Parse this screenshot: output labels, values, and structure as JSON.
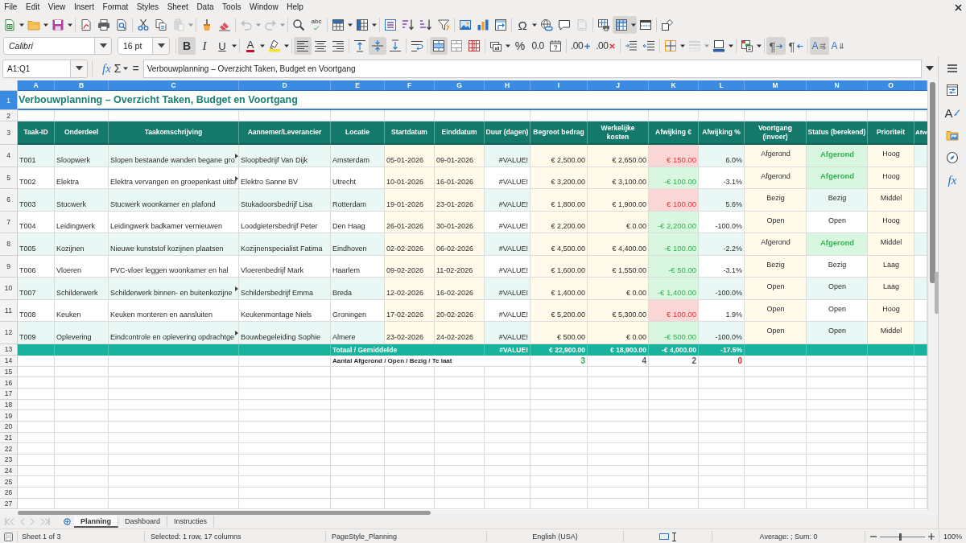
{
  "menu_bar": [
    "File",
    "Edit",
    "View",
    "Insert",
    "Format",
    "Styles",
    "Sheet",
    "Data",
    "Tools",
    "Window",
    "Help"
  ],
  "standard_toolbar": [
    [
      {
        "kind": "new",
        "active": false,
        "disabled": false,
        "dropdown": true
      },
      {
        "kind": "open",
        "active": false,
        "disabled": false,
        "dropdown": true
      },
      {
        "kind": "save",
        "active": false,
        "disabled": false,
        "dropdown": true
      }
    ],
    [
      {
        "kind": "pdf",
        "active": false,
        "disabled": false,
        "dropdown": false
      },
      {
        "kind": "print",
        "active": false,
        "disabled": false,
        "dropdown": false
      },
      {
        "kind": "preview",
        "active": false,
        "disabled": false,
        "dropdown": false
      }
    ],
    [
      {
        "kind": "cut",
        "active": false,
        "disabled": false,
        "dropdown": false
      },
      {
        "kind": "copy",
        "active": false,
        "disabled": false,
        "dropdown": false
      },
      {
        "kind": "paste",
        "active": false,
        "disabled": true,
        "dropdown": true
      }
    ],
    [
      {
        "kind": "clone",
        "active": false,
        "disabled": false,
        "dropdown": false
      },
      {
        "kind": "clear",
        "active": false,
        "disabled": false,
        "dropdown": false
      }
    ],
    [
      {
        "kind": "undo",
        "active": false,
        "disabled": true,
        "dropdown": true
      },
      {
        "kind": "redo",
        "active": false,
        "disabled": true,
        "dropdown": true
      }
    ],
    [
      {
        "kind": "find",
        "active": false,
        "disabled": false,
        "dropdown": false
      },
      {
        "kind": "spelling",
        "glyph": "abc",
        "active": false,
        "disabled": false,
        "dropdown": false
      }
    ],
    [
      {
        "kind": "rows",
        "active": false,
        "disabled": false,
        "dropdown": true
      },
      {
        "kind": "columns",
        "active": false,
        "disabled": false,
        "dropdown": true
      }
    ],
    [
      {
        "kind": "sort",
        "active": false,
        "disabled": false,
        "dropdown": false
      },
      {
        "kind": "sort_asc",
        "active": false,
        "disabled": false,
        "dropdown": false
      },
      {
        "kind": "sort_desc",
        "active": false,
        "disabled": false,
        "dropdown": false
      },
      {
        "kind": "filter",
        "active": false,
        "disabled": false,
        "dropdown": false
      }
    ],
    [
      {
        "kind": "image",
        "active": false,
        "disabled": false,
        "dropdown": false
      },
      {
        "kind": "chart",
        "active": false,
        "disabled": false,
        "dropdown": false
      },
      {
        "kind": "pivot",
        "active": false,
        "disabled": false,
        "dropdown": false
      }
    ],
    [
      {
        "kind": "special",
        "glyph": "Ω",
        "active": false,
        "disabled": false,
        "dropdown": true
      },
      {
        "kind": "hyperlink",
        "active": false,
        "disabled": false,
        "dropdown": false
      },
      {
        "kind": "comment",
        "active": false,
        "disabled": false,
        "dropdown": false
      },
      {
        "kind": "headers",
        "active": false,
        "disabled": true,
        "dropdown": false
      }
    ],
    [
      {
        "kind": "print_area",
        "active": false,
        "disabled": false,
        "dropdown": false
      },
      {
        "kind": "freeze",
        "active": true,
        "disabled": false,
        "dropdown": true
      },
      {
        "kind": "split",
        "active": false,
        "disabled": false,
        "dropdown": false
      }
    ],
    [
      {
        "kind": "draw",
        "active": false,
        "disabled": false,
        "dropdown": false
      }
    ]
  ],
  "formatting_toolbar": {
    "font_name": "Calibri",
    "font_size": "16 pt",
    "groups": [
      [
        {
          "kind": "bold",
          "glyph": "B",
          "active": true,
          "disabled": false,
          "dropdown": false
        },
        {
          "kind": "italic",
          "glyph": "I",
          "active": false,
          "disabled": false,
          "dropdown": false
        },
        {
          "kind": "underline",
          "glyph": "U",
          "active": false,
          "disabled": false,
          "dropdown": true
        }
      ],
      [
        {
          "kind": "font_color",
          "glyph": "A",
          "active": false,
          "disabled": false,
          "dropdown": true
        },
        {
          "kind": "highlight",
          "active": false,
          "disabled": false,
          "dropdown": true
        }
      ],
      [
        {
          "kind": "align_left",
          "active": true,
          "disabled": false,
          "dropdown": false
        },
        {
          "kind": "align_center",
          "active": false,
          "disabled": false,
          "dropdown": false
        },
        {
          "kind": "align_right",
          "active": false,
          "disabled": false,
          "dropdown": false
        }
      ],
      [
        {
          "kind": "valign_top",
          "active": false,
          "disabled": false,
          "dropdown": false
        },
        {
          "kind": "valign_middle",
          "active": true,
          "disabled": false,
          "dropdown": false
        },
        {
          "kind": "valign_bottom",
          "active": false,
          "disabled": false,
          "dropdown": false
        }
      ],
      [
        {
          "kind": "wrap",
          "active": false,
          "disabled": false,
          "dropdown": false
        }
      ],
      [
        {
          "kind": "merge_center",
          "active": true,
          "disabled": false,
          "dropdown": false
        },
        {
          "kind": "merge",
          "active": false,
          "disabled": false,
          "dropdown": false
        },
        {
          "kind": "unmerge",
          "active": false,
          "disabled": false,
          "dropdown": false
        }
      ],
      [
        {
          "kind": "currency",
          "active": false,
          "disabled": false,
          "dropdown": true
        },
        {
          "kind": "percent",
          "glyph": "%",
          "active": false,
          "disabled": false,
          "dropdown": false
        },
        {
          "kind": "number",
          "glyph": "0.0",
          "active": false,
          "disabled": false,
          "dropdown": false
        },
        {
          "kind": "date",
          "active": false,
          "disabled": false,
          "dropdown": false
        }
      ],
      [
        {
          "kind": "add_decimal",
          "glyph": ".00",
          "active": false,
          "disabled": false,
          "dropdown": false
        },
        {
          "kind": "del_decimal",
          "glyph": ".00",
          "active": false,
          "disabled": false,
          "dropdown": false
        }
      ],
      [
        {
          "kind": "indent_inc",
          "active": false,
          "disabled": false,
          "dropdown": false
        },
        {
          "kind": "indent_dec",
          "active": false,
          "disabled": false,
          "dropdown": false
        }
      ],
      [
        {
          "kind": "borders",
          "active": false,
          "disabled": false,
          "dropdown": true
        },
        {
          "kind": "border_style",
          "active": false,
          "disabled": true,
          "dropdown": true
        },
        {
          "kind": "border_color",
          "active": false,
          "disabled": false,
          "dropdown": true
        }
      ],
      [
        {
          "kind": "conditional",
          "active": false,
          "disabled": false,
          "dropdown": true
        }
      ],
      [
        {
          "kind": "ltr",
          "glyph": "¶",
          "active": true,
          "disabled": false,
          "dropdown": false
        },
        {
          "kind": "rtl",
          "glyph": "¶",
          "active": false,
          "disabled": false,
          "dropdown": false
        }
      ],
      [
        {
          "kind": "text_dir",
          "glyph": "A",
          "active": true,
          "disabled": false,
          "dropdown": false
        },
        {
          "kind": "vertical",
          "glyph": "A",
          "active": false,
          "disabled": false,
          "dropdown": false
        }
      ]
    ]
  },
  "formula_bar": {
    "name_box": "A1:Q1",
    "buttons": [
      {
        "kind": "function_wizard",
        "glyph": "fx",
        "dropdown": false
      },
      {
        "kind": "sum",
        "glyph": "Σ",
        "dropdown": true
      },
      {
        "kind": "formula",
        "glyph": "=",
        "dropdown": false
      }
    ],
    "content": "Verbouwplanning – Overzicht Taken, Budget en Voortgang"
  },
  "sidebar": [
    {
      "kind": "properties"
    },
    {
      "kind": "styles",
      "glyph": "A"
    },
    {
      "kind": "gallery"
    },
    {
      "kind": "navigator"
    },
    {
      "kind": "functions",
      "glyph": "fx"
    }
  ],
  "sheet": {
    "column_headers": [
      {
        "label": "A",
        "selected": true
      },
      {
        "label": "B",
        "selected": true
      },
      {
        "label": "C",
        "selected": true
      },
      {
        "label": "D",
        "selected": true
      },
      {
        "label": "E",
        "selected": true
      },
      {
        "label": "F",
        "selected": true
      },
      {
        "label": "G",
        "selected": true
      },
      {
        "label": "H",
        "selected": true
      },
      {
        "label": "I",
        "selected": true
      },
      {
        "label": "J",
        "selected": true
      },
      {
        "label": "K",
        "selected": true
      },
      {
        "label": "L",
        "selected": true
      },
      {
        "label": "M",
        "selected": true
      },
      {
        "label": "N",
        "selected": true
      },
      {
        "label": "O",
        "selected": true
      }
    ],
    "row_headers": [
      {
        "label": "1",
        "selected": true
      },
      {
        "label": "2",
        "selected": false
      },
      {
        "label": "3",
        "selected": false
      },
      {
        "label": "4",
        "selected": false
      },
      {
        "label": "5",
        "selected": false
      },
      {
        "label": "6",
        "selected": false
      },
      {
        "label": "7",
        "selected": false
      },
      {
        "label": "8",
        "selected": false
      },
      {
        "label": "9",
        "selected": false
      },
      {
        "label": "10",
        "selected": false
      },
      {
        "label": "11",
        "selected": false
      },
      {
        "label": "12",
        "selected": false
      },
      {
        "label": "13",
        "selected": false
      },
      {
        "label": "14",
        "selected": false
      },
      {
        "label": "15",
        "selected": false
      },
      {
        "label": "16",
        "selected": false
      },
      {
        "label": "17",
        "selected": false
      },
      {
        "label": "18",
        "selected": false
      },
      {
        "label": "19",
        "selected": false
      },
      {
        "label": "20",
        "selected": false
      },
      {
        "label": "21",
        "selected": false
      },
      {
        "label": "22",
        "selected": false
      },
      {
        "label": "23",
        "selected": false
      },
      {
        "label": "24",
        "selected": false
      },
      {
        "label": "25",
        "selected": false
      },
      {
        "label": "26",
        "selected": false
      },
      {
        "label": "27",
        "selected": false
      }
    ],
    "title": "Verbouwplanning – Overzicht Taken, Budget en Voortgang",
    "columns": [
      "Taak-ID",
      "Onderdeel",
      "Taakomschrijving",
      "Aannemer/Leverancier",
      "Locatie",
      "Startdatum",
      "Einddatum",
      "Duur (dagen)",
      "Begroot bedrag",
      "Werkelijke kosten",
      "Afwijking €",
      "Afwijking %",
      "Voortgang (invoer)",
      "Status (berekend)",
      "Prioriteit",
      "Afw"
    ],
    "rows": [
      {
        "id": "T001",
        "part": "Sloopwerk",
        "description": "Slopen bestaande wanden begane gro",
        "description_overflow": true,
        "contractor": "Sloopbedrijf Van Dijk",
        "location": "Amsterdam",
        "start": "05-01-2026",
        "end": "09-01-2026",
        "duration": "#VALUE!",
        "budget": "€ 2,500.00",
        "actual": "€ 2,650.00",
        "deviation": "€ 150.00",
        "over_budget": true,
        "deviation_pct": "6.0%",
        "progress": "Afgerond",
        "status": "Afgerond",
        "status_done": true,
        "priority": "Hoog"
      },
      {
        "id": "T002",
        "part": "Elektra",
        "description": "Elektra vervangen en groepenkast uitbr",
        "description_overflow": true,
        "contractor": "Elektro Sanne BV",
        "location": "Utrecht",
        "start": "10-01-2026",
        "end": "16-01-2026",
        "duration": "#VALUE!",
        "budget": "€ 3,200.00",
        "actual": "€ 3,100.00",
        "deviation": "-€ 100.00",
        "over_budget": false,
        "deviation_pct": "-3.1%",
        "progress": "Afgerond",
        "status": "Afgerond",
        "status_done": true,
        "priority": "Hoog"
      },
      {
        "id": "T003",
        "part": "Stucwerk",
        "description": "Stucwerk woonkamer en plafond",
        "description_overflow": false,
        "contractor": "Stukadoorsbedrijf Lisa",
        "location": "Rotterdam",
        "start": "19-01-2026",
        "end": "23-01-2026",
        "duration": "#VALUE!",
        "budget": "€ 1,800.00",
        "actual": "€ 1,900.00",
        "deviation": "€ 100.00",
        "over_budget": true,
        "deviation_pct": "5.6%",
        "progress": "Bezig",
        "status": "Bezig",
        "status_done": false,
        "priority": "Middel"
      },
      {
        "id": "T004",
        "part": "Leidingwerk",
        "description": "Leidingwerk badkamer vernieuwen",
        "description_overflow": false,
        "contractor": "Loodgietersbedrijf Peter",
        "location": "Den Haag",
        "start": "26-01-2026",
        "end": "30-01-2026",
        "duration": "#VALUE!",
        "budget": "€ 2,200.00",
        "actual": "€ 0.00",
        "deviation": "-€ 2,200.00",
        "over_budget": false,
        "deviation_pct": "-100.0%",
        "progress": "Open",
        "status": "Open",
        "status_done": false,
        "priority": "Hoog"
      },
      {
        "id": "T005",
        "part": "Kozijnen",
        "description": "Nieuwe kunststof kozijnen plaatsen",
        "description_overflow": false,
        "contractor": "Kozijnenspecialist Fatima",
        "location": "Eindhoven",
        "start": "02-02-2026",
        "end": "06-02-2026",
        "duration": "#VALUE!",
        "budget": "€ 4,500.00",
        "actual": "€ 4,400.00",
        "deviation": "-€ 100.00",
        "over_budget": false,
        "deviation_pct": "-2.2%",
        "progress": "Afgerond",
        "status": "Afgerond",
        "status_done": true,
        "priority": "Middel"
      },
      {
        "id": "T006",
        "part": "Vloeren",
        "description": "PVC-vloer leggen woonkamer en hal",
        "description_overflow": false,
        "contractor": "Vloerenbedrijf Mark",
        "location": "Haarlem",
        "start": "09-02-2026",
        "end": "11-02-2026",
        "duration": "#VALUE!",
        "budget": "€ 1,600.00",
        "actual": "€ 1,550.00",
        "deviation": "-€ 50.00",
        "over_budget": false,
        "deviation_pct": "-3.1%",
        "progress": "Bezig",
        "status": "Bezig",
        "status_done": false,
        "priority": "Laag"
      },
      {
        "id": "T007",
        "part": "Schilderwerk",
        "description": "Schilderwerk binnen- en buitenkozijne",
        "description_overflow": true,
        "contractor": "Schildersbedrijf Emma",
        "location": "Breda",
        "start": "12-02-2026",
        "end": "16-02-2026",
        "duration": "#VALUE!",
        "budget": "€ 1,400.00",
        "actual": "€ 0.00",
        "deviation": "-€ 1,400.00",
        "over_budget": false,
        "deviation_pct": "-100.0%",
        "progress": "Open",
        "status": "Open",
        "status_done": false,
        "priority": "Laag"
      },
      {
        "id": "T008",
        "part": "Keuken",
        "description": "Keuken monteren en aansluiten",
        "description_overflow": false,
        "contractor": "Keukenmontage Niels",
        "location": "Groningen",
        "start": "17-02-2026",
        "end": "20-02-2026",
        "duration": "#VALUE!",
        "budget": "€ 5,200.00",
        "actual": "€ 5,300.00",
        "deviation": "€ 100.00",
        "over_budget": true,
        "deviation_pct": "1.9%",
        "progress": "Open",
        "status": "Open",
        "status_done": false,
        "priority": "Hoog"
      },
      {
        "id": "T009",
        "part": "Oplevering",
        "description": "Eindcontrole en oplevering opdrachtge",
        "description_overflow": true,
        "contractor": "Bouwbegeleiding Sophie",
        "location": "Almere",
        "start": "23-02-2026",
        "end": "24-02-2026",
        "duration": "#VALUE!",
        "budget": "€ 500.00",
        "actual": "€ 0.00",
        "deviation": "-€ 500.00",
        "over_budget": false,
        "deviation_pct": "-100.0%",
        "progress": "Open",
        "status": "Open",
        "status_done": false,
        "priority": "Middel"
      }
    ],
    "totals": {
      "label": "Totaal / Gemiddelde",
      "duration": "#VALUE!",
      "budget": "€ 22,900.00",
      "actual": "€ 18,900.00",
      "deviation": "-€ 4,000.00",
      "deviation_pct": "-17.5%"
    },
    "counts": {
      "label": "Aantal Afgerond / Open / Bezig / Te laat",
      "values": [
        {
          "text": "3",
          "color": "#2fae4a"
        },
        {
          "text": "4",
          "color": "#555555"
        },
        {
          "text": "2",
          "color": "#555555"
        },
        {
          "text": "0",
          "color": "#e02424"
        }
      ]
    }
  },
  "sheet_tabs": [
    {
      "label": "Planning",
      "selected": true
    },
    {
      "label": "Dashboard",
      "selected": false
    },
    {
      "label": "Instructies",
      "selected": false
    }
  ],
  "status_bar": {
    "sheet": "Sheet 1 of 3",
    "selection": "Selected: 1 row, 17 columns",
    "page_style": "PageStyle_Planning",
    "language": "English (USA)",
    "summary": "Average: ; Sum: 0",
    "zoom_slider": {
      "level": 0.45
    },
    "zoom": "100%"
  }
}
